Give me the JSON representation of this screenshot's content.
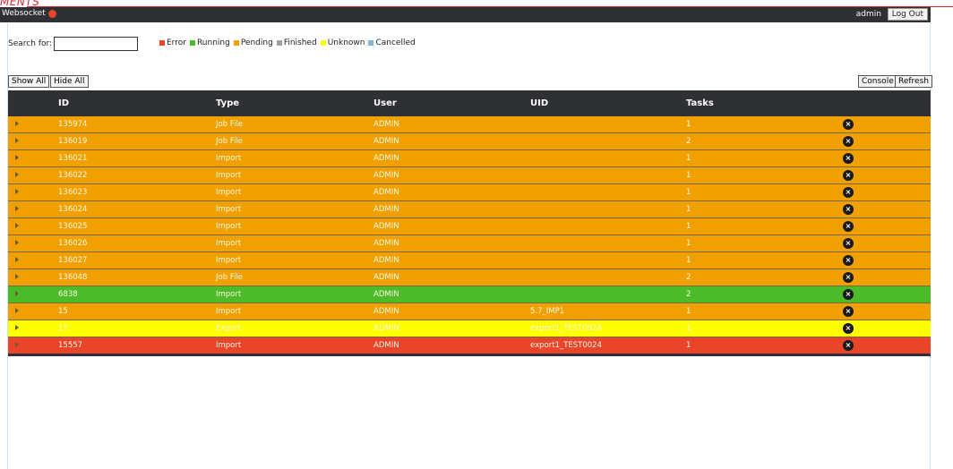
{
  "brand": "MENTS",
  "topbar": {
    "websocket_label": "Websocket",
    "user": "admin",
    "logout_label": "Log Out"
  },
  "search": {
    "label": "Search for:",
    "value": ""
  },
  "legend": [
    {
      "label": "Error",
      "color": "#e8452a"
    },
    {
      "label": "Running",
      "color": "#4cbb2a"
    },
    {
      "label": "Pending",
      "color": "#f0a000"
    },
    {
      "label": "Finished",
      "color": "#a0a0a0"
    },
    {
      "label": "Unknown",
      "color": "#ffff00"
    },
    {
      "label": "Cancelled",
      "color": "#8ab4d8"
    }
  ],
  "buttons": {
    "show_all": "Show All",
    "hide_all": "Hide All",
    "console": "Console",
    "refresh": "Refresh"
  },
  "table": {
    "headers": [
      "ID",
      "Type",
      "User",
      "UID",
      "Tasks"
    ],
    "rows": [
      {
        "id": "135974",
        "type": "Job File",
        "user": "ADMIN",
        "uid": "",
        "tasks": "1",
        "status": "Pending"
      },
      {
        "id": "136019",
        "type": "Job File",
        "user": "ADMIN",
        "uid": "",
        "tasks": "2",
        "status": "Pending"
      },
      {
        "id": "136021",
        "type": "Import",
        "user": "ADMIN",
        "uid": "",
        "tasks": "1",
        "status": "Pending"
      },
      {
        "id": "136022",
        "type": "Import",
        "user": "ADMIN",
        "uid": "",
        "tasks": "1",
        "status": "Pending"
      },
      {
        "id": "136023",
        "type": "Import",
        "user": "ADMIN",
        "uid": "",
        "tasks": "1",
        "status": "Pending"
      },
      {
        "id": "136024",
        "type": "Import",
        "user": "ADMIN",
        "uid": "",
        "tasks": "1",
        "status": "Pending"
      },
      {
        "id": "136025",
        "type": "Import",
        "user": "ADMIN",
        "uid": "",
        "tasks": "1",
        "status": "Pending"
      },
      {
        "id": "136026",
        "type": "Import",
        "user": "ADMIN",
        "uid": "",
        "tasks": "1",
        "status": "Pending"
      },
      {
        "id": "136027",
        "type": "Import",
        "user": "ADMIN",
        "uid": "",
        "tasks": "1",
        "status": "Pending"
      },
      {
        "id": "136048",
        "type": "Job File",
        "user": "ADMIN",
        "uid": "",
        "tasks": "2",
        "status": "Pending"
      },
      {
        "id": "6838",
        "type": "Import",
        "user": "ADMIN",
        "uid": "",
        "tasks": "2",
        "status": "Running"
      },
      {
        "id": "15",
        "type": "Import",
        "user": "ADMIN",
        "uid": "5.7_IMP1",
        "tasks": "1",
        "status": "Pending"
      },
      {
        "id": "17",
        "type": "Export",
        "user": "ADMIN",
        "uid": "export1_TEST0024",
        "tasks": "1",
        "status": "Unknown"
      },
      {
        "id": "15557",
        "type": "Import",
        "user": "ADMIN",
        "uid": "export1_TEST0024",
        "tasks": "1",
        "status": "Error"
      }
    ]
  }
}
